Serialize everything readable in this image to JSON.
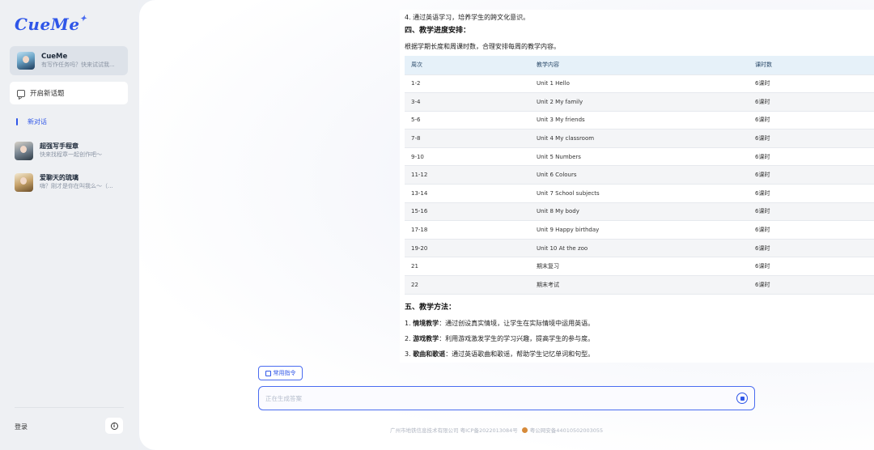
{
  "app": {
    "logo": "CueMe",
    "logo_star": "✦"
  },
  "sidebar": {
    "bot": {
      "name": "CueMe",
      "desc": "有写作任务吗？快来试试我..."
    },
    "new_topic_label": "开启新话题",
    "current_conversation": "新对话",
    "history": [
      {
        "name": "超强写手程章",
        "desc": "快来找程章一起创作吧～"
      },
      {
        "name": "爱聊天的琉璃",
        "desc": "嗨？刚才是你在叫我么～（..."
      }
    ],
    "login_label": "登录",
    "info_icon": "i"
  },
  "content": {
    "line_goal4": "4. 通过英语学习，培养学生的跨文化意识。",
    "section4_title": "四、教学进度安排：",
    "section4_intro": "根据学期长度和周课时数，合理安排每周的教学内容。",
    "table": {
      "headers": [
        "周次",
        "教学内容",
        "课时数"
      ],
      "rows": [
        [
          "1-2",
          "Unit 1 Hello",
          "6课时"
        ],
        [
          "3-4",
          "Unit 2 My family",
          "6课时"
        ],
        [
          "5-6",
          "Unit 3 My friends",
          "6课时"
        ],
        [
          "7-8",
          "Unit 4 My classroom",
          "6课时"
        ],
        [
          "9-10",
          "Unit 5 Numbers",
          "6课时"
        ],
        [
          "11-12",
          "Unit 6 Colours",
          "6课时"
        ],
        [
          "13-14",
          "Unit 7 School subjects",
          "6课时"
        ],
        [
          "15-16",
          "Unit 8 My body",
          "6课时"
        ],
        [
          "17-18",
          "Unit 9 Happy birthday",
          "6课时"
        ],
        [
          "19-20",
          "Unit 10 At the zoo",
          "6课时"
        ],
        [
          "21",
          "期末复习",
          "6课时"
        ],
        [
          "22",
          "期末考试",
          "6课时"
        ]
      ]
    },
    "section5_title": "五、教学方法：",
    "methods": [
      {
        "num": "1. ",
        "bold": "情境教学",
        "text": "：通过创设真实情境，让学生在实际情境中运用英语。"
      },
      {
        "num": "2. ",
        "bold": "游戏教学",
        "text": "：利用游戏激发学生的学习兴趣，提高学生的参与度。"
      },
      {
        "num": "3. ",
        "bold": "歌曲和歌谣",
        "text": "：通过英语歌曲和歌谣，帮助学生记忆单词和句型。"
      }
    ]
  },
  "input": {
    "commands_label": "常用指令",
    "placeholder": "正在生成答案"
  },
  "footer": {
    "company": "广州市地铁信息技术有限公司 粤ICP备2022013084号",
    "police": "粤公网安备44010502003055"
  }
}
